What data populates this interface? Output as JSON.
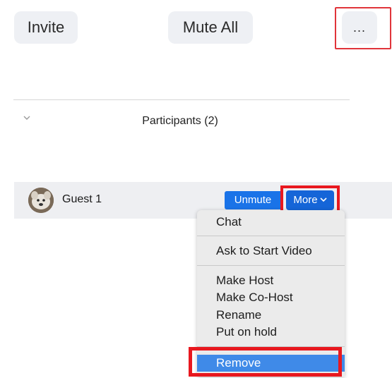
{
  "toolbar": {
    "invite_label": "Invite",
    "mute_all_label": "Mute All",
    "more_label": "..."
  },
  "participants": {
    "header": "Participants (2)",
    "rows": [
      {
        "name": "Guest 1",
        "unmute_label": "Unmute",
        "more_label": "More"
      }
    ]
  },
  "menu": {
    "items": [
      {
        "label": "Chat"
      },
      {
        "label": "Ask to Start Video"
      },
      {
        "label": "Make Host"
      },
      {
        "label": "Make Co-Host"
      },
      {
        "label": "Rename"
      },
      {
        "label": "Put on hold"
      },
      {
        "label": "Remove",
        "selected": true
      }
    ]
  },
  "colors": {
    "highlight_red": "#e8181f",
    "primary_blue": "#1a73e8",
    "selected_blue": "#3f8ae8",
    "row_bg": "#eeeff2",
    "menu_bg": "#ebebeb"
  },
  "icons": {
    "collapse": "chevron-down-icon",
    "more_caret": "chevron-down-icon",
    "avatar": "user-avatar"
  }
}
